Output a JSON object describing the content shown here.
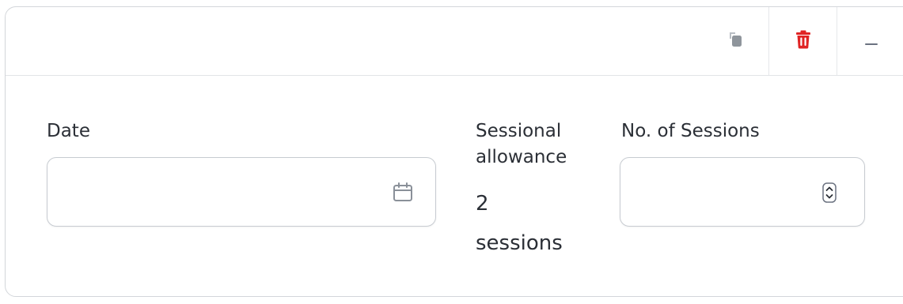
{
  "toolbar": {
    "icons": {
      "copy": "copy-icon",
      "delete": "trash-icon",
      "collapse": "minus-icon"
    },
    "colors": {
      "copy": "#9aa0a6",
      "delete": "#e02424",
      "collapse": "#6b7280"
    }
  },
  "fields": {
    "date": {
      "label": "Date",
      "value": "",
      "icon": "calendar-icon"
    },
    "sessional_allowance": {
      "label_line1": "Sessional",
      "label_line2": "allowance",
      "value_line1": "2",
      "value_line2": "sessions"
    },
    "sessions": {
      "label": "No. of Sessions",
      "value": "",
      "icon": "stepper-icon"
    }
  }
}
